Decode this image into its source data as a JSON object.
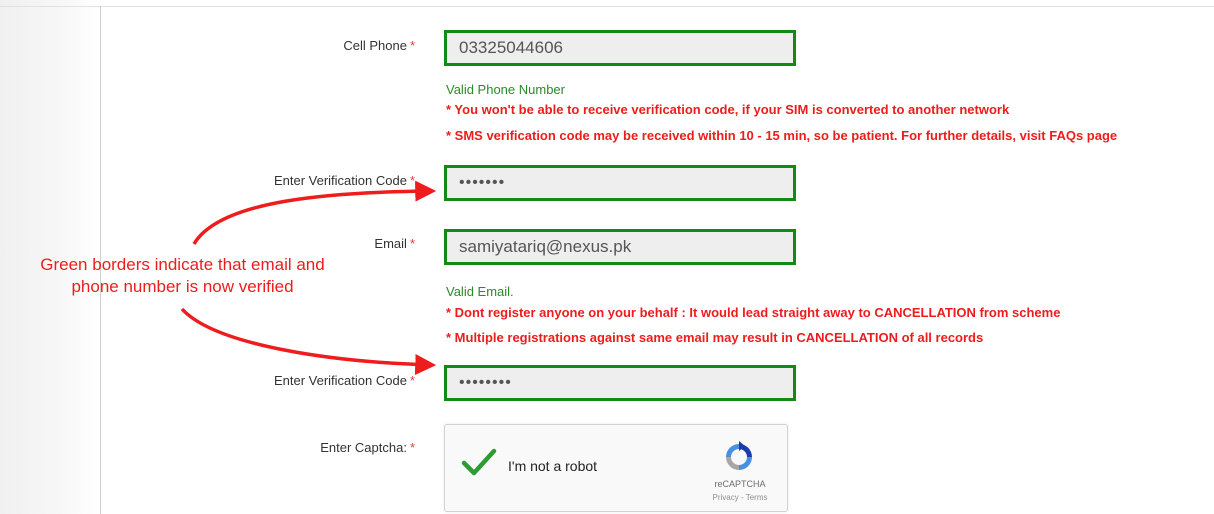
{
  "form": {
    "cell_phone": {
      "label": "Cell Phone",
      "required": "*",
      "value": "03325044606",
      "valid_message": "Valid Phone Number",
      "warnings": [
        "* You won't be able to receive verification code, if your SIM is converted to another network",
        "* SMS verification code may be received within 10 - 15 min, so be patient. For further details, visit FAQs page"
      ]
    },
    "phone_code": {
      "label": "Enter Verification Code",
      "required": "*",
      "value": "•••••••"
    },
    "email": {
      "label": "Email",
      "required": "*",
      "value": "samiyatariq@nexus.pk",
      "valid_message": "Valid Email.",
      "warnings": [
        "* Dont register anyone on your behalf : It would lead straight away to CANCELLATION from scheme",
        "* Multiple registrations against same email may result in CANCELLATION of all records"
      ]
    },
    "email_code": {
      "label": "Enter Verification Code",
      "required": "*",
      "value": "••••••••"
    },
    "captcha": {
      "label": "Enter Captcha:",
      "required": "*",
      "checkbox_label": "I'm not a robot",
      "brand": "reCAPTCHA",
      "links": "Privacy - Terms",
      "icon": "recaptcha-logo-icon"
    }
  },
  "annotation": {
    "lines": [
      "Green borders indicate that email and",
      "phone number is now verified"
    ],
    "color": "#ee1c1c"
  },
  "colors": {
    "verified_border": "#138a13",
    "valid_text": "#2a8a2a",
    "warning_text": "#ee1c1c",
    "required_mark": "#e23c3c"
  }
}
